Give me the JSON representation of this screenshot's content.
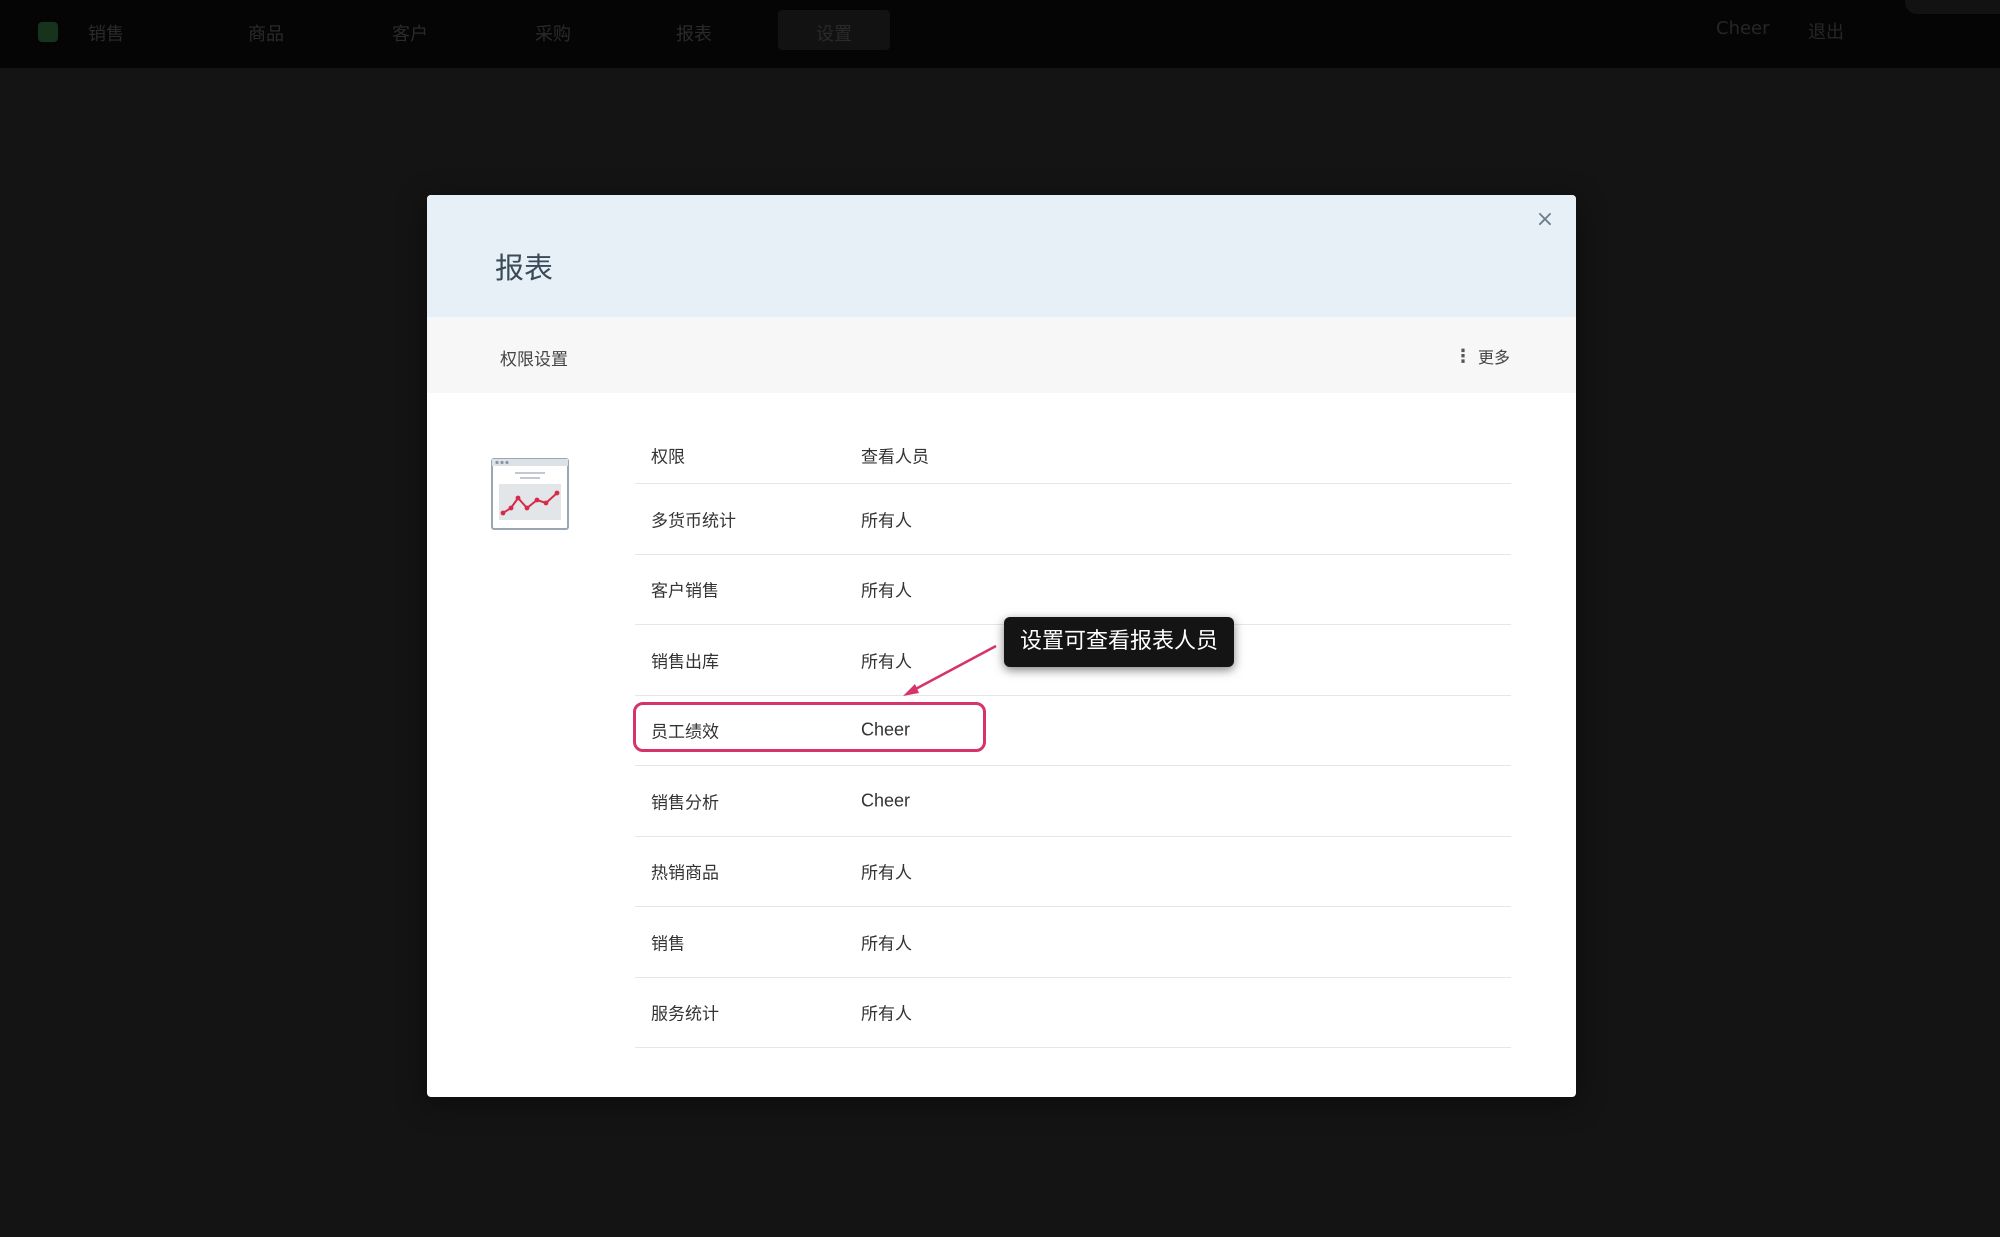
{
  "topbar": {
    "nav": [
      "销售",
      "商品",
      "客户",
      "采购",
      "报表",
      "设置"
    ],
    "user": "Cheer",
    "logout": "退出"
  },
  "modal": {
    "title": "报表",
    "close_icon": "×",
    "subbar_label": "权限设置",
    "more_icon": "⋮",
    "more_label": "更多"
  },
  "table": {
    "headers": [
      "权限",
      "查看人员"
    ],
    "rows": [
      {
        "name": "多货币统计",
        "viewer": "所有人"
      },
      {
        "name": "客户销售",
        "viewer": "所有人"
      },
      {
        "name": "销售出库",
        "viewer": "所有人"
      },
      {
        "name": "员工绩效",
        "viewer": "Cheer"
      },
      {
        "name": "销售分析",
        "viewer": "Cheer"
      },
      {
        "name": "热销商品",
        "viewer": "所有人"
      },
      {
        "name": "销售",
        "viewer": "所有人"
      },
      {
        "name": "服务统计",
        "viewer": "所有人"
      }
    ]
  },
  "annotation": {
    "tooltip": "设置可查看报表人员",
    "highlight_color": "#d6336c"
  },
  "colors": {
    "header_bg": "#e8f0f7",
    "chart_red": "#d62a4a"
  }
}
